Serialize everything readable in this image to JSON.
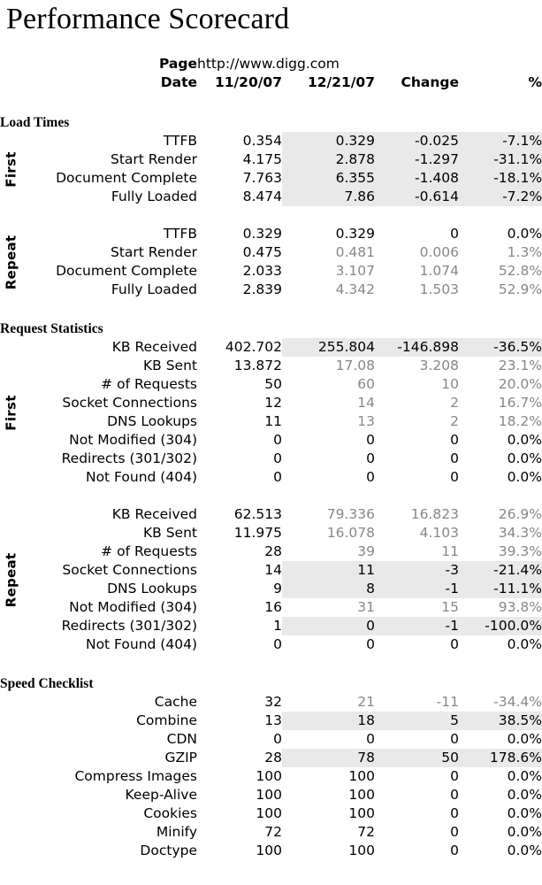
{
  "title": "Performance Scorecard",
  "header": {
    "page_label": "Page",
    "page_url": "http://www.digg.com",
    "date_label": "Date",
    "columns": [
      "11/20/07",
      "12/21/07",
      "Change",
      "%"
    ]
  },
  "colors": {
    "text": "#000000",
    "worse_text": "#878787",
    "better_background": "#e9e9e9",
    "page_background": "#ffffff"
  },
  "rail_labels": {
    "first": "First",
    "repeat": "Repeat"
  },
  "sections": [
    {
      "heading": "Load Times",
      "groups": [
        {
          "rail": "First",
          "rows": [
            {
              "label": "TTFB",
              "v1": "0.354",
              "v2": "0.329",
              "change": "-0.025",
              "pct": "-7.1%",
              "state": "better"
            },
            {
              "label": "Start Render",
              "v1": "4.175",
              "v2": "2.878",
              "change": "-1.297",
              "pct": "-31.1%",
              "state": "better"
            },
            {
              "label": "Document Complete",
              "v1": "7.763",
              "v2": "6.355",
              "change": "-1.408",
              "pct": "-18.1%",
              "state": "better"
            },
            {
              "label": "Fully Loaded",
              "v1": "8.474",
              "v2": "7.86",
              "change": "-0.614",
              "pct": "-7.2%",
              "state": "better"
            }
          ]
        },
        {
          "rail": "Repeat",
          "rows": [
            {
              "label": "TTFB",
              "v1": "0.329",
              "v2": "0.329",
              "change": "0",
              "pct": "0.0%",
              "state": "neutral"
            },
            {
              "label": "Start Render",
              "v1": "0.475",
              "v2": "0.481",
              "change": "0.006",
              "pct": "1.3%",
              "state": "worse"
            },
            {
              "label": "Document Complete",
              "v1": "2.033",
              "v2": "3.107",
              "change": "1.074",
              "pct": "52.8%",
              "state": "worse"
            },
            {
              "label": "Fully Loaded",
              "v1": "2.839",
              "v2": "4.342",
              "change": "1.503",
              "pct": "52.9%",
              "state": "worse"
            }
          ]
        }
      ]
    },
    {
      "heading": "Request Statistics",
      "groups": [
        {
          "rail": "First",
          "rows": [
            {
              "label": "KB Received",
              "v1": "402.702",
              "v2": "255.804",
              "change": "-146.898",
              "pct": "-36.5%",
              "state": "better"
            },
            {
              "label": "KB Sent",
              "v1": "13.872",
              "v2": "17.08",
              "change": "3.208",
              "pct": "23.1%",
              "state": "worse"
            },
            {
              "label": "# of Requests",
              "v1": "50",
              "v2": "60",
              "change": "10",
              "pct": "20.0%",
              "state": "worse"
            },
            {
              "label": "Socket Connections",
              "v1": "12",
              "v2": "14",
              "change": "2",
              "pct": "16.7%",
              "state": "worse"
            },
            {
              "label": "DNS Lookups",
              "v1": "11",
              "v2": "13",
              "change": "2",
              "pct": "18.2%",
              "state": "worse"
            },
            {
              "label": "Not Modified (304)",
              "v1": "0",
              "v2": "0",
              "change": "0",
              "pct": "0.0%",
              "state": "neutral"
            },
            {
              "label": "Redirects (301/302)",
              "v1": "0",
              "v2": "0",
              "change": "0",
              "pct": "0.0%",
              "state": "neutral"
            },
            {
              "label": "Not Found (404)",
              "v1": "0",
              "v2": "0",
              "change": "0",
              "pct": "0.0%",
              "state": "neutral"
            }
          ]
        },
        {
          "rail": "Repeat",
          "rows": [
            {
              "label": "KB Received",
              "v1": "62.513",
              "v2": "79.336",
              "change": "16.823",
              "pct": "26.9%",
              "state": "worse"
            },
            {
              "label": "KB Sent",
              "v1": "11.975",
              "v2": "16.078",
              "change": "4.103",
              "pct": "34.3%",
              "state": "worse"
            },
            {
              "label": "# of Requests",
              "v1": "28",
              "v2": "39",
              "change": "11",
              "pct": "39.3%",
              "state": "worse"
            },
            {
              "label": "Socket Connections",
              "v1": "14",
              "v2": "11",
              "change": "-3",
              "pct": "-21.4%",
              "state": "better"
            },
            {
              "label": "DNS Lookups",
              "v1": "9",
              "v2": "8",
              "change": "-1",
              "pct": "-11.1%",
              "state": "better"
            },
            {
              "label": "Not Modified (304)",
              "v1": "16",
              "v2": "31",
              "change": "15",
              "pct": "93.8%",
              "state": "worse"
            },
            {
              "label": "Redirects (301/302)",
              "v1": "1",
              "v2": "0",
              "change": "-1",
              "pct": "-100.0%",
              "state": "better"
            },
            {
              "label": "Not Found (404)",
              "v1": "0",
              "v2": "0",
              "change": "0",
              "pct": "0.0%",
              "state": "neutral"
            }
          ]
        }
      ]
    },
    {
      "heading": "Speed Checklist",
      "groups": [
        {
          "rail": "",
          "rows": [
            {
              "label": "Cache",
              "v1": "32",
              "v2": "21",
              "change": "-11",
              "pct": "-34.4%",
              "state": "worse"
            },
            {
              "label": "Combine",
              "v1": "13",
              "v2": "18",
              "change": "5",
              "pct": "38.5%",
              "state": "better"
            },
            {
              "label": "CDN",
              "v1": "0",
              "v2": "0",
              "change": "0",
              "pct": "0.0%",
              "state": "neutral"
            },
            {
              "label": "GZIP",
              "v1": "28",
              "v2": "78",
              "change": "50",
              "pct": "178.6%",
              "state": "better"
            },
            {
              "label": "Compress Images",
              "v1": "100",
              "v2": "100",
              "change": "0",
              "pct": "0.0%",
              "state": "neutral"
            },
            {
              "label": "Keep-Alive",
              "v1": "100",
              "v2": "100",
              "change": "0",
              "pct": "0.0%",
              "state": "neutral"
            },
            {
              "label": "Cookies",
              "v1": "100",
              "v2": "100",
              "change": "0",
              "pct": "0.0%",
              "state": "neutral"
            },
            {
              "label": "Minify",
              "v1": "72",
              "v2": "72",
              "change": "0",
              "pct": "0.0%",
              "state": "neutral"
            },
            {
              "label": "Doctype",
              "v1": "100",
              "v2": "100",
              "change": "0",
              "pct": "0.0%",
              "state": "neutral"
            }
          ]
        }
      ]
    }
  ]
}
